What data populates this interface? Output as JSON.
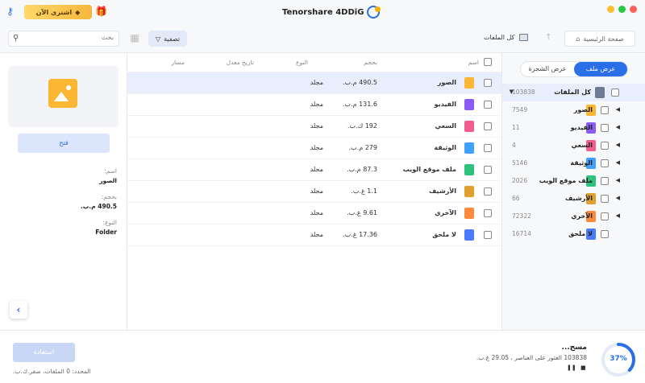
{
  "titlebar": {
    "app_title": "Tenorshare 4DDiG",
    "buy_label": "اشترى الآن",
    "window_controls": [
      {
        "name": "close",
        "color": "#ff5f57"
      },
      {
        "name": "minimize",
        "color": "#febc2e"
      },
      {
        "name": "zoom",
        "color": "#28c840"
      }
    ]
  },
  "toolbar": {
    "search_placeholder": "بحث",
    "filter_label": "تصفية",
    "path_label": "كل الملفات",
    "home_label": "صفحة الرئيسية"
  },
  "tree": {
    "view_options": {
      "file_view": "عرض ملف",
      "tree_view": "عرض الشجرة"
    },
    "items": [
      {
        "label": "كل الملفات",
        "count": "103838",
        "icon": "drive-icon",
        "color": "#6d7a8f"
      },
      {
        "label": "الصور",
        "count": "7549",
        "icon": "photo-icon",
        "color": "#fbb734"
      },
      {
        "label": "الفيديو",
        "count": "11",
        "icon": "video-icon",
        "color": "#8a5cf5"
      },
      {
        "label": "السعي",
        "count": "4",
        "icon": "audio-icon",
        "color": "#f25d8e"
      },
      {
        "label": "الوثيقة",
        "count": "5146",
        "icon": "document-icon",
        "color": "#3fa0ff"
      },
      {
        "label": "ملف موقع الويب",
        "count": "2026",
        "icon": "web-icon",
        "color": "#2ec27e"
      },
      {
        "label": "الأرشيف",
        "count": "66",
        "icon": "archive-icon",
        "color": "#e0a030"
      },
      {
        "label": "الآخري",
        "count": "72322",
        "icon": "other-icon",
        "color": "#ff8a3d"
      },
      {
        "label": "لا ملحق",
        "count": "16714",
        "icon": "unknown-icon",
        "color": "#4a7bff"
      }
    ]
  },
  "table": {
    "headers": {
      "name": "اسم",
      "size": "بحجم",
      "type": "النوع",
      "modified": "تاريخ معدل",
      "path": "مسار"
    },
    "rows": [
      {
        "name": "الصور",
        "size": "490.5 م.ب.",
        "type": "مجلد",
        "icon": "photo-icon",
        "color": "#fbb734"
      },
      {
        "name": "الفيديو",
        "size": "131.6 م.ب.",
        "type": "مجلد",
        "icon": "video-icon",
        "color": "#8a5cf5"
      },
      {
        "name": "السعي",
        "size": "192 ك.ب.",
        "type": "مجلد",
        "icon": "audio-icon",
        "color": "#f25d8e"
      },
      {
        "name": "الوثيقة",
        "size": "279 م.ب.",
        "type": "مجلد",
        "icon": "document-icon",
        "color": "#3fa0ff"
      },
      {
        "name": "ملف موقع الويب",
        "size": "87.3 م.ب.",
        "type": "مجلد",
        "icon": "web-icon",
        "color": "#2ec27e"
      },
      {
        "name": "الأرشيف",
        "size": "1.1 غ.ب.",
        "type": "مجلد",
        "icon": "archive-icon",
        "color": "#e0a030"
      },
      {
        "name": "الآخري",
        "size": "9.61 غ.ب.",
        "type": "مجلد",
        "icon": "other-icon",
        "color": "#ff8a3d"
      },
      {
        "name": "لا ملحق",
        "size": "17.36 غ.ب.",
        "type": "مجلد",
        "icon": "unknown-icon",
        "color": "#4a7bff"
      }
    ]
  },
  "preview": {
    "open_label": "فتح",
    "name_key": "اسم:",
    "name_value": "الصور",
    "size_key": "بحجم:",
    "size_value": "490.5 م.ب.",
    "type_key": "النوع:",
    "type_value": "Folder"
  },
  "bottom": {
    "restore_label": "استعادة",
    "selected_info": "المحدد: 0 الملفات، صفر.ك.ب.",
    "scan_title": "مسح...",
    "scan_detail": "103838 العثور على العناصر ، 29.05 غ.ب.",
    "progress_text": "37%",
    "progress_value": 0.37,
    "accent": "#2a6ee8"
  }
}
